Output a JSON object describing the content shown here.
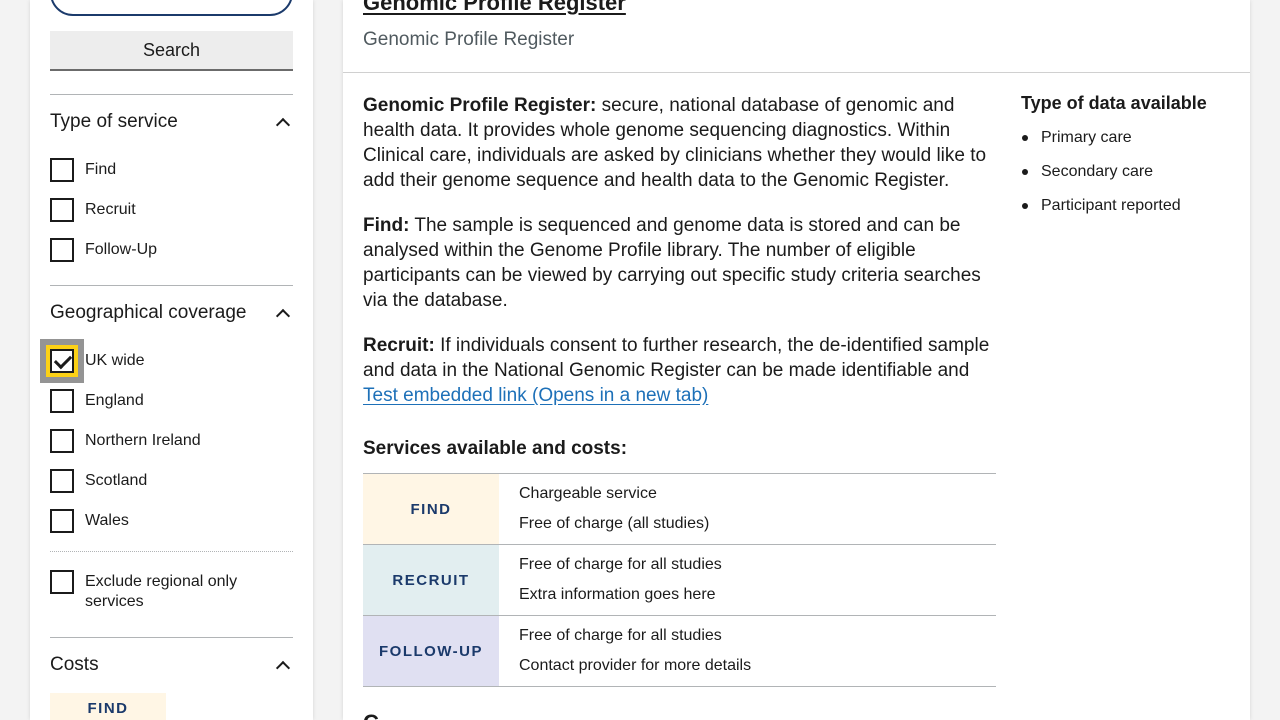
{
  "sidebar": {
    "search": {
      "placeholder": "",
      "value": "",
      "button_label": "Search"
    },
    "filters": {
      "type_of_service": {
        "heading": "Type of service",
        "options": [
          {
            "label": "Find",
            "checked": false
          },
          {
            "label": "Recruit",
            "checked": false
          },
          {
            "label": "Follow-Up",
            "checked": false
          }
        ]
      },
      "geographical_coverage": {
        "heading": "Geographical coverage",
        "options": [
          {
            "label": "UK wide",
            "checked": true
          },
          {
            "label": "England",
            "checked": false
          },
          {
            "label": "Northern Ireland",
            "checked": false
          },
          {
            "label": "Scotland",
            "checked": false
          },
          {
            "label": "Wales",
            "checked": false
          }
        ],
        "exclude_regional": {
          "label": "Exclude regional only services",
          "checked": false
        }
      },
      "costs": {
        "heading": "Costs",
        "tag": "FIND"
      }
    }
  },
  "main": {
    "title": "Genomic Profile Register",
    "subtitle": "Genomic Profile Register",
    "paragraphs": {
      "intro_label": "Genomic Profile Register:",
      "intro_text": " secure, national database of genomic and health data. It provides whole genome sequencing diagnostics. Within Clinical care, individuals are asked by clinicians whether they would like to add their genome sequence and health data to the Genomic Register.",
      "find_label": "Find:",
      "find_text": " The sample is sequenced and genome data is stored and can be analysed within the Genome Profile library. The number of eligible participants can be viewed by carrying out specific study criteria searches via the database.",
      "recruit_label": "Recruit:",
      "recruit_text": " If individuals consent to further research, the de-identified sample and data in the National Genomic Register can be made identifiable and ",
      "link_text": "Test embedded link (Opens in a new tab)"
    },
    "services": {
      "heading": "Services available and costs:",
      "rows": [
        {
          "tag": "FIND",
          "bg": "#fff6e5",
          "lines": [
            "Chargeable service",
            "Free of charge (all studies)"
          ]
        },
        {
          "tag": "RECRUIT",
          "bg": "#e2eef0",
          "lines": [
            "Free of charge for all studies",
            "Extra information goes here"
          ]
        },
        {
          "tag": "FOLLOW-UP",
          "bg": "#e0e0f2",
          "lines": [
            "Free of charge for all studies",
            "Contact provider for more details"
          ]
        }
      ]
    },
    "data_types": {
      "heading": "Type of data available",
      "items": [
        "Primary care",
        "Secondary care",
        "Participant reported"
      ]
    },
    "next_section_partial": "C"
  },
  "colors": {
    "accent": "#1b3a6b",
    "link": "#1d70b8",
    "focus": "#fcd116",
    "find_bg": "#fff6e5",
    "recruit_bg": "#e2eef0",
    "followup_bg": "#e0e0f2"
  }
}
